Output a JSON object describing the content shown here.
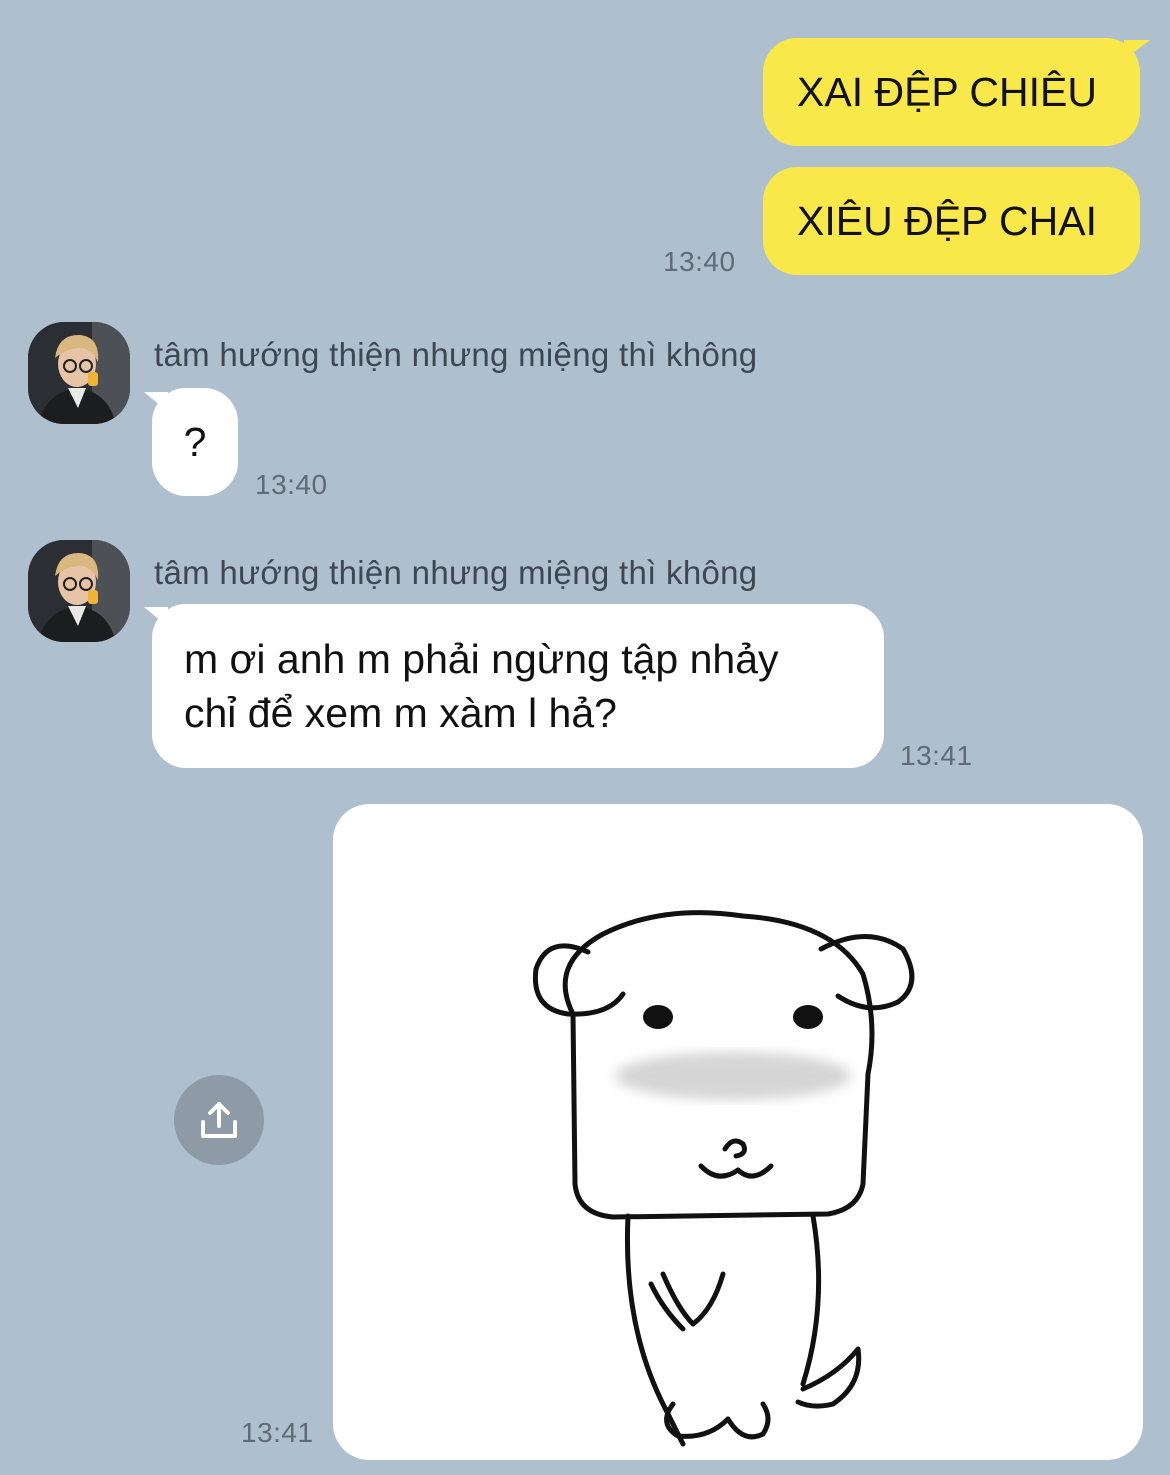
{
  "chat": {
    "sent_1": {
      "text": "XAI ĐỆP CHIÊU"
    },
    "sent_2": {
      "text": "XIÊU ĐỆP CHAI",
      "time": "13:40"
    },
    "received_1": {
      "sender": "tâm hướng thiện nhưng miệng thì không",
      "text": "?",
      "time": "13:40"
    },
    "received_2": {
      "sender": "tâm hướng thiện nhưng miệng thì không",
      "line1": "m ơi anh m phải ngừng tập nhảy",
      "line2": "chỉ để xem m xàm l hả?",
      "time": "13:41"
    },
    "sticker": {
      "time": "13:41",
      "icon": "dog-sticker"
    }
  },
  "colors": {
    "background": "#aebfce",
    "sent_bubble": "#f9e84a",
    "received_bubble": "#ffffff"
  },
  "icons": {
    "share": "share-icon"
  }
}
